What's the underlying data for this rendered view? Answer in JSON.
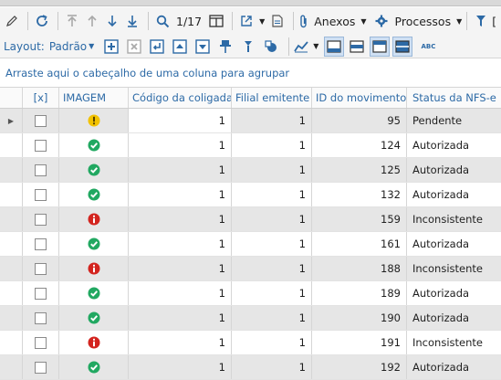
{
  "toolbar": {
    "page_indicator": "1/17",
    "anexos_label": "Anexos",
    "processos_label": "Processos"
  },
  "layout_bar": {
    "label": "Layout:",
    "selected": "Padrão",
    "abc_label": "ABC"
  },
  "group_hint": "Arraste aqui o cabeçalho de uma coluna para agrupar",
  "grid": {
    "headers": {
      "check": "[x]",
      "image": "IMAGEM",
      "codigo": "Código da coligada",
      "filial": "Filial emitente",
      "id": "ID do movimento",
      "status": "Status da NFS-e"
    },
    "rows": [
      {
        "icon": "warning",
        "codigo": "1",
        "filial": "1",
        "id": "95",
        "status": "Pendente"
      },
      {
        "icon": "ok",
        "codigo": "1",
        "filial": "1",
        "id": "124",
        "status": "Autorizada"
      },
      {
        "icon": "ok",
        "codigo": "1",
        "filial": "1",
        "id": "125",
        "status": "Autorizada"
      },
      {
        "icon": "ok",
        "codigo": "1",
        "filial": "1",
        "id": "132",
        "status": "Autorizada"
      },
      {
        "icon": "error",
        "codigo": "1",
        "filial": "1",
        "id": "159",
        "status": "Inconsistente"
      },
      {
        "icon": "ok",
        "codigo": "1",
        "filial": "1",
        "id": "161",
        "status": "Autorizada"
      },
      {
        "icon": "error",
        "codigo": "1",
        "filial": "1",
        "id": "188",
        "status": "Inconsistente"
      },
      {
        "icon": "ok",
        "codigo": "1",
        "filial": "1",
        "id": "189",
        "status": "Autorizada"
      },
      {
        "icon": "ok",
        "codigo": "1",
        "filial": "1",
        "id": "190",
        "status": "Autorizada"
      },
      {
        "icon": "error",
        "codigo": "1",
        "filial": "1",
        "id": "191",
        "status": "Inconsistente"
      },
      {
        "icon": "ok",
        "codigo": "1",
        "filial": "1",
        "id": "192",
        "status": "Autorizada"
      }
    ]
  },
  "colors": {
    "accent": "#2d6aa6",
    "ok": "#21a861",
    "warning": "#f2c200",
    "error": "#d3241f",
    "row_alt": "#e6e6e6"
  }
}
